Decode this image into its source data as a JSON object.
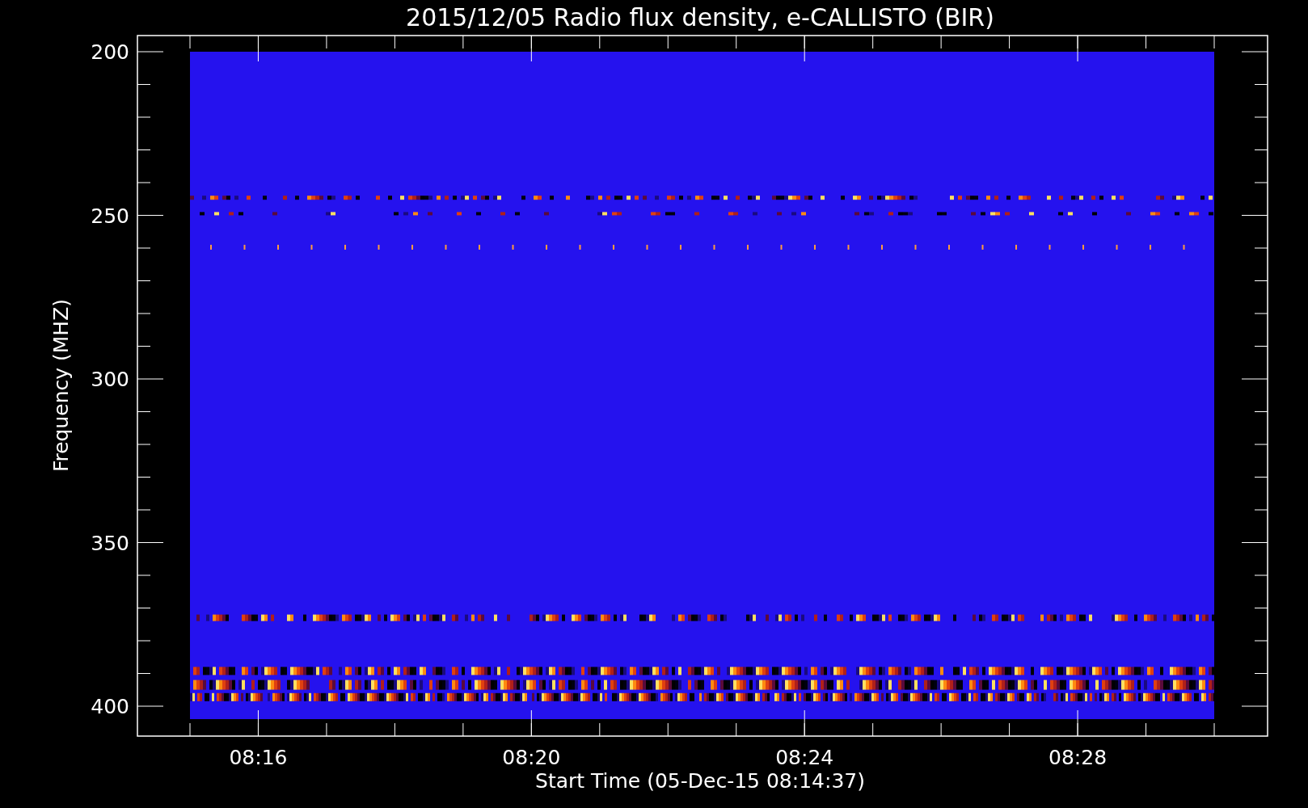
{
  "title": "2015/12/05  Radio flux density, e-CALLISTO (BIR)",
  "y_axis": {
    "label": "Frequency (MHZ)",
    "ticks": [
      "200",
      "250",
      "300",
      "350",
      "400"
    ]
  },
  "x_axis": {
    "label": "Start Time (05-Dec-15 08:14:37)",
    "ticks": [
      "08:16",
      "08:20",
      "08:24",
      "08:28"
    ]
  }
}
